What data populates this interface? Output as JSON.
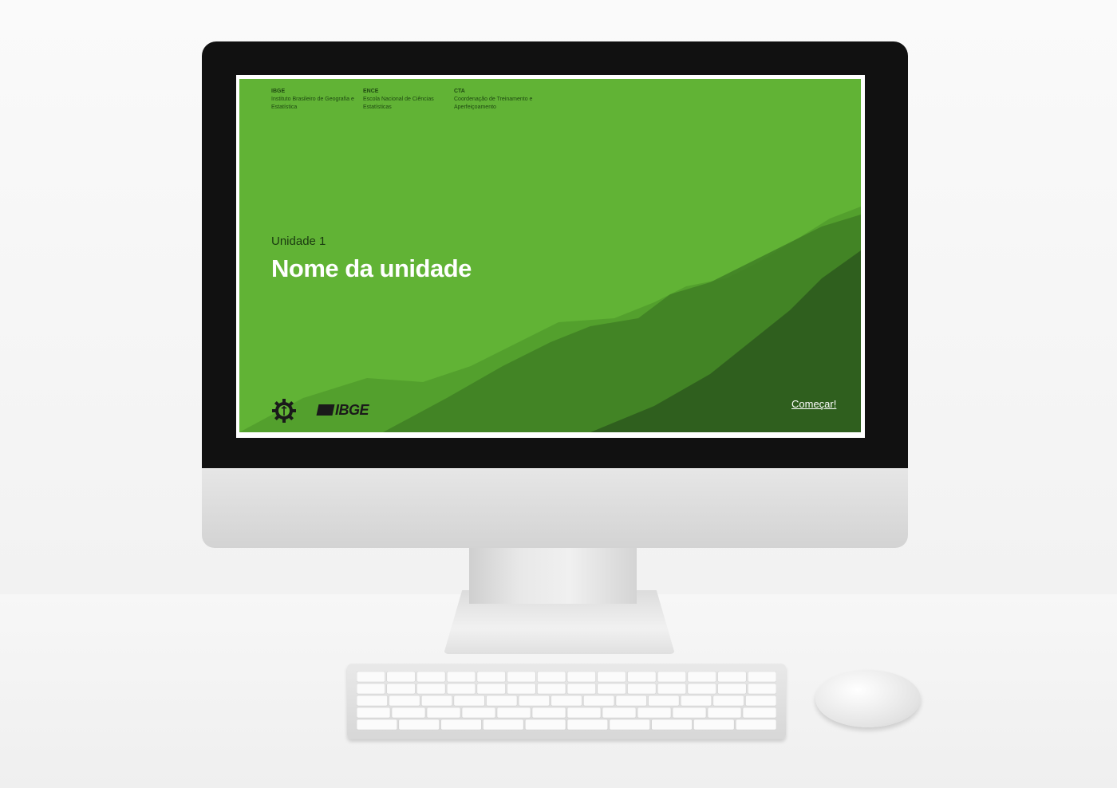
{
  "slide": {
    "orgs": [
      {
        "abbr": "IBGE",
        "name": "Instituto Brasileiro de Geografia e Estatística"
      },
      {
        "abbr": "ENCE",
        "name": "Escola Nacional de Ciências Estatísticas"
      },
      {
        "abbr": "CTA",
        "name": "Coordenação de Treinamento e Aperfeiçoamento"
      }
    ],
    "unit_label": "Unidade 1",
    "unit_title": "Nome da unidade",
    "logo_text": "IBGE",
    "start_label": "Começar!",
    "colors": {
      "background": "#61b335",
      "mountains": "#2f5f1e",
      "title": "#ffffff"
    },
    "icons": {
      "emblem": "gear-emblem-icon",
      "logo": "ibge-logo"
    }
  }
}
